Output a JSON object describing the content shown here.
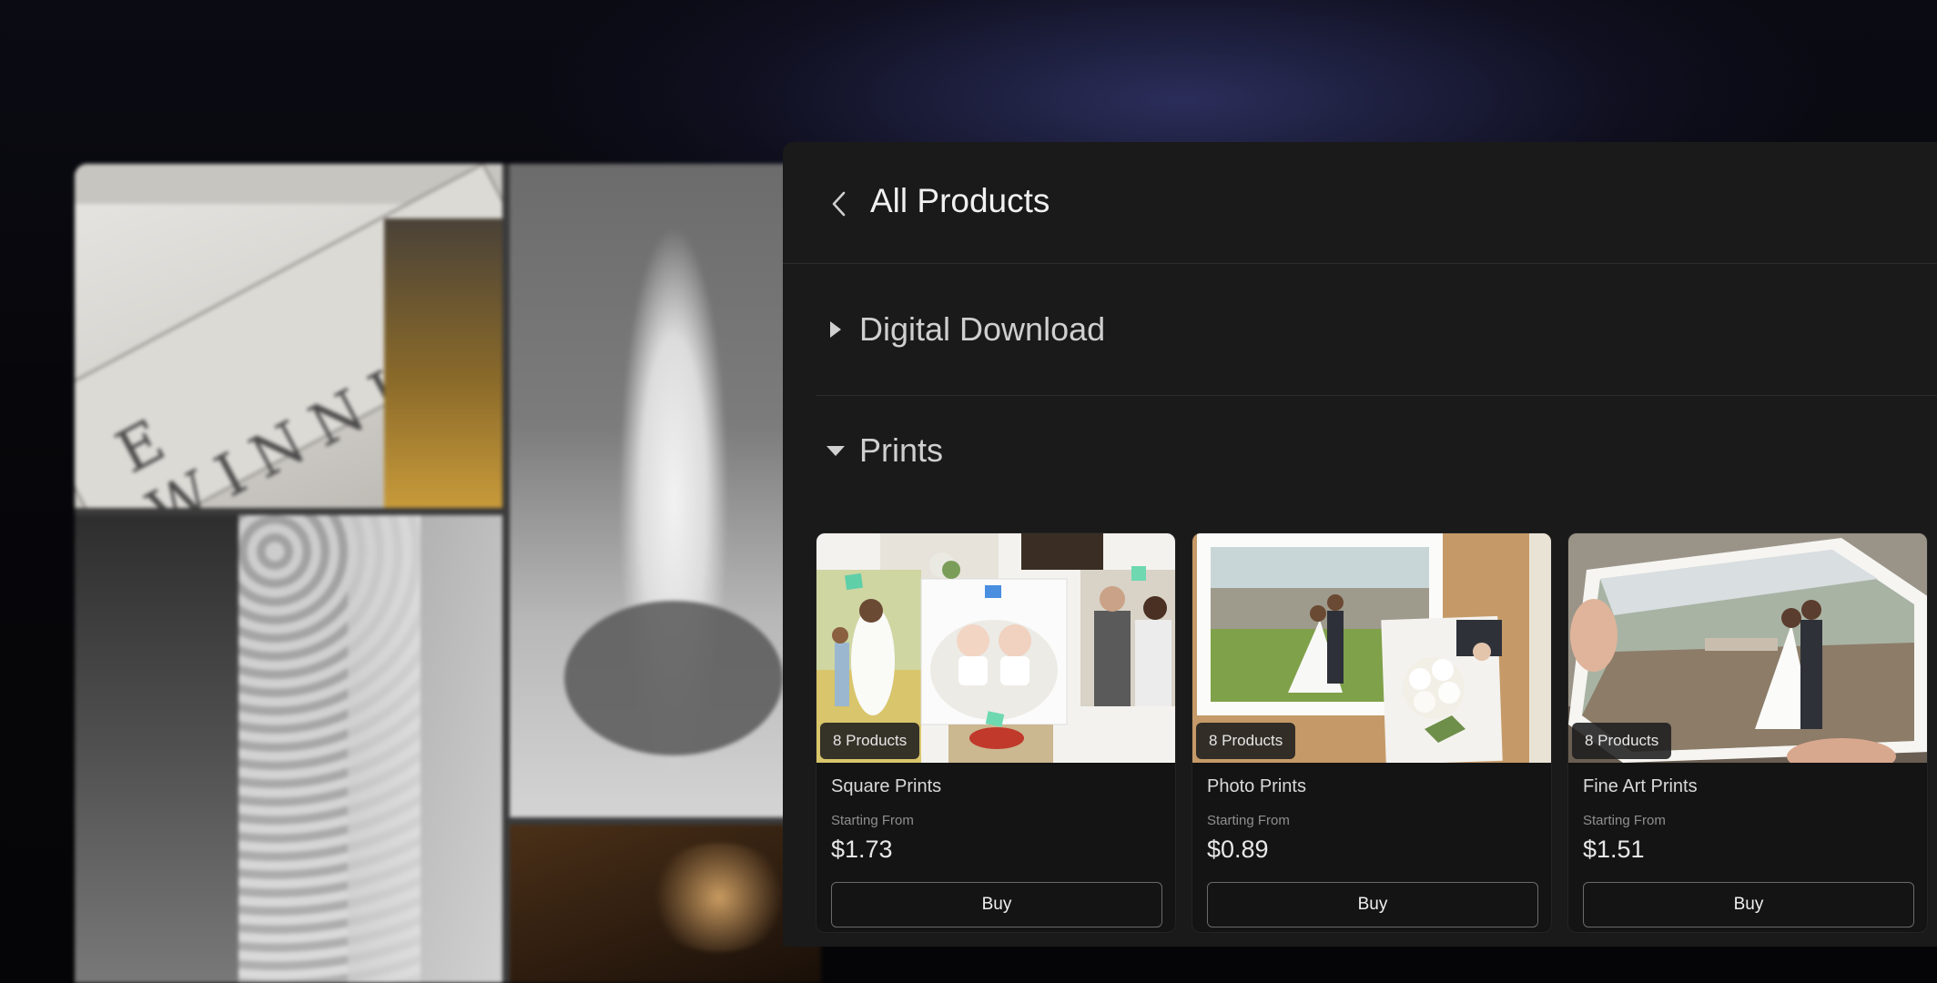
{
  "header": {
    "title": "All Products",
    "back_icon": "chevron-left-icon"
  },
  "sections": {
    "digital": {
      "label": "Digital Download",
      "expanded": false,
      "icon": "caret-right-icon"
    },
    "prints": {
      "label": "Prints",
      "expanded": true,
      "icon": "caret-down-icon",
      "products": [
        {
          "name": "Square Prints",
          "badge": "8 Products",
          "price_label": "Starting From",
          "price": "$1.73",
          "button": "Buy"
        },
        {
          "name": "Photo Prints",
          "badge": "8 Products",
          "price_label": "Starting From",
          "price": "$0.89",
          "button": "Buy"
        },
        {
          "name": "Fine Art Prints",
          "badge": "8 Products",
          "price_label": "Starting From",
          "price": "$1.51",
          "button": "Buy"
        }
      ]
    }
  },
  "gallery": {
    "sign_text": "E WINNIPEG"
  },
  "colors": {
    "panel_bg": "#1a1a1a",
    "card_bg": "#141414",
    "text_primary": "#f1f1f1",
    "accent_glow": "#464b96"
  }
}
